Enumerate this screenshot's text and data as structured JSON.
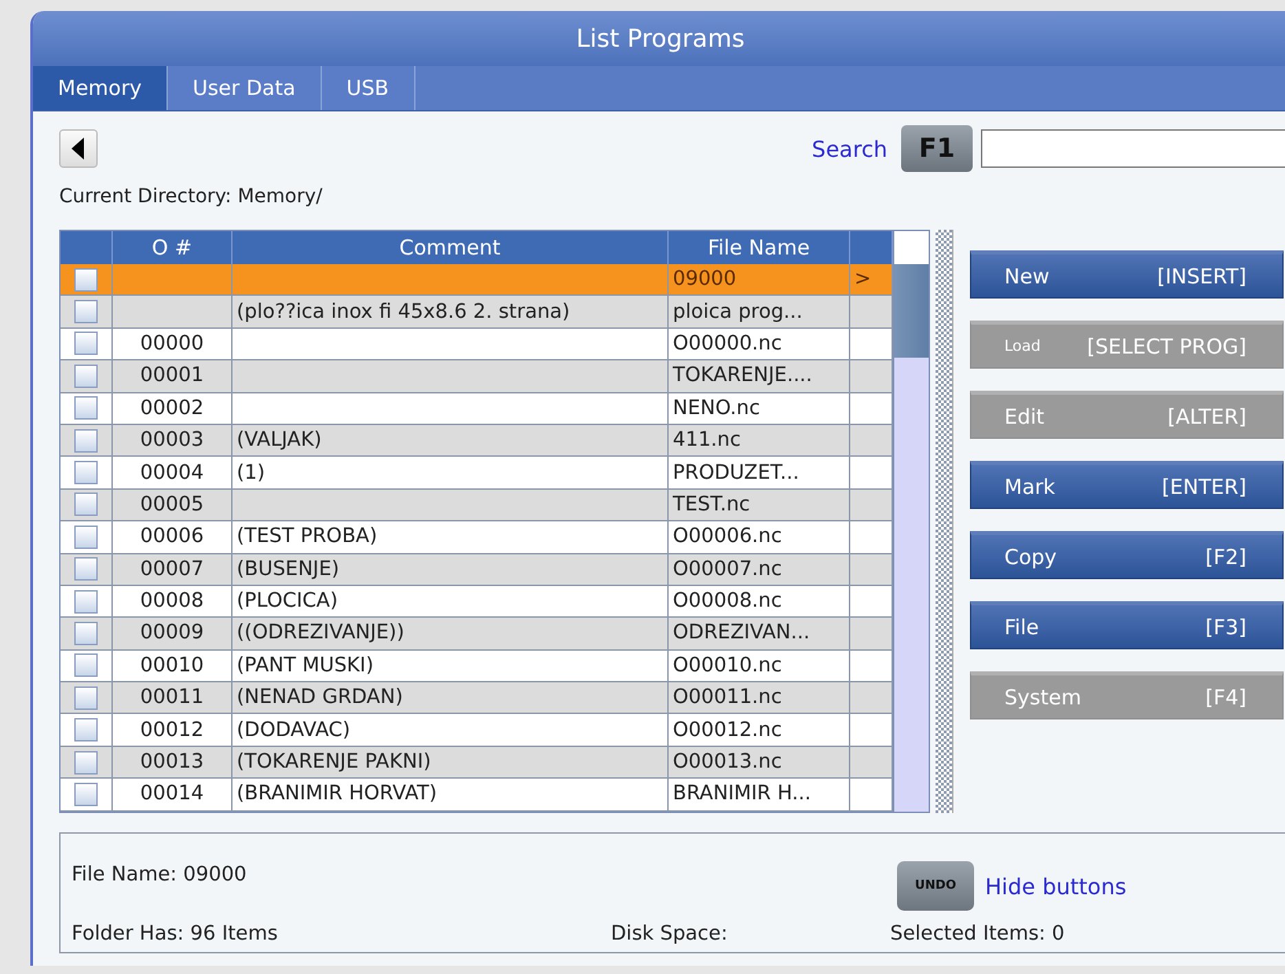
{
  "window": {
    "title": "List Programs"
  },
  "tabs": [
    {
      "label": "Memory",
      "selected": true
    },
    {
      "label": "User Data",
      "selected": false
    },
    {
      "label": "USB",
      "selected": false
    }
  ],
  "search": {
    "label": "Search",
    "key": "F1"
  },
  "current_directory": "Current Directory: Memory/",
  "table": {
    "columns": [
      "O #",
      "Comment",
      "File Name"
    ],
    "rows": [
      {
        "checked": false,
        "selected": true,
        "number": "",
        "comment": "",
        "file": "09000",
        "marker": ">"
      },
      {
        "checked": false,
        "selected": false,
        "number": "",
        "comment": "(plo??ica inox fi 45x8.6 2. strana)",
        "file": "ploica prog..."
      },
      {
        "checked": false,
        "selected": false,
        "number": "00000",
        "comment": "",
        "file": "O00000.nc"
      },
      {
        "checked": false,
        "selected": false,
        "number": "00001",
        "comment": "",
        "file": "TOKARENJE...."
      },
      {
        "checked": false,
        "selected": false,
        "number": "00002",
        "comment": "",
        "file": "NENO.nc"
      },
      {
        "checked": false,
        "selected": false,
        "number": "00003",
        "comment": "(VALJAK)",
        "file": "411.nc"
      },
      {
        "checked": false,
        "selected": false,
        "number": "00004",
        "comment": "(1)",
        "file": "PRODUZET..."
      },
      {
        "checked": false,
        "selected": false,
        "number": "00005",
        "comment": "",
        "file": "TEST.nc"
      },
      {
        "checked": false,
        "selected": false,
        "number": "00006",
        "comment": "(TEST PROBA)",
        "file": "O00006.nc"
      },
      {
        "checked": false,
        "selected": false,
        "number": "00007",
        "comment": "(BUSENJE)",
        "file": "O00007.nc"
      },
      {
        "checked": false,
        "selected": false,
        "number": "00008",
        "comment": "(PLOCICA)",
        "file": "O00008.nc"
      },
      {
        "checked": false,
        "selected": false,
        "number": "00009",
        "comment": "((ODREZIVANJE))",
        "file": "ODREZIVAN..."
      },
      {
        "checked": false,
        "selected": false,
        "number": "00010",
        "comment": "(PANT MUSKI)",
        "file": "O00010.nc"
      },
      {
        "checked": false,
        "selected": false,
        "number": "00011",
        "comment": "(NENAD GRDAN)",
        "file": "O00011.nc"
      },
      {
        "checked": false,
        "selected": false,
        "number": "00012",
        "comment": "(DODAVAC)",
        "file": "O00012.nc"
      },
      {
        "checked": false,
        "selected": false,
        "number": "00013",
        "comment": "(TOKARENJE PAKNI)",
        "file": "O00013.nc"
      },
      {
        "checked": false,
        "selected": false,
        "number": "00014",
        "comment": "(BRANIMIR HORVAT)",
        "file": "BRANIMIR H..."
      }
    ]
  },
  "buttons": [
    {
      "label": "New",
      "key": "[INSERT]",
      "disabled": false,
      "small_label": false
    },
    {
      "label": "Load",
      "key": "[SELECT PROG]",
      "disabled": true,
      "small_label": true
    },
    {
      "label": "Edit",
      "key": "[ALTER]",
      "disabled": true,
      "small_label": false
    },
    {
      "label": "Mark",
      "key": "[ENTER]",
      "disabled": false,
      "small_label": false
    },
    {
      "label": "Copy",
      "key": "[F2]",
      "disabled": false,
      "small_label": false
    },
    {
      "label": "File",
      "key": "[F3]",
      "disabled": false,
      "small_label": false
    },
    {
      "label": "System",
      "key": "[F4]",
      "disabled": true,
      "small_label": false
    }
  ],
  "status": {
    "file_name": "File Name: 09000",
    "undo_key": "UNDO",
    "hide_buttons": "Hide buttons",
    "folder": "Folder Has: 96 Items",
    "disk_space": "Disk Space:",
    "selected_items": "Selected Items: 0"
  }
}
